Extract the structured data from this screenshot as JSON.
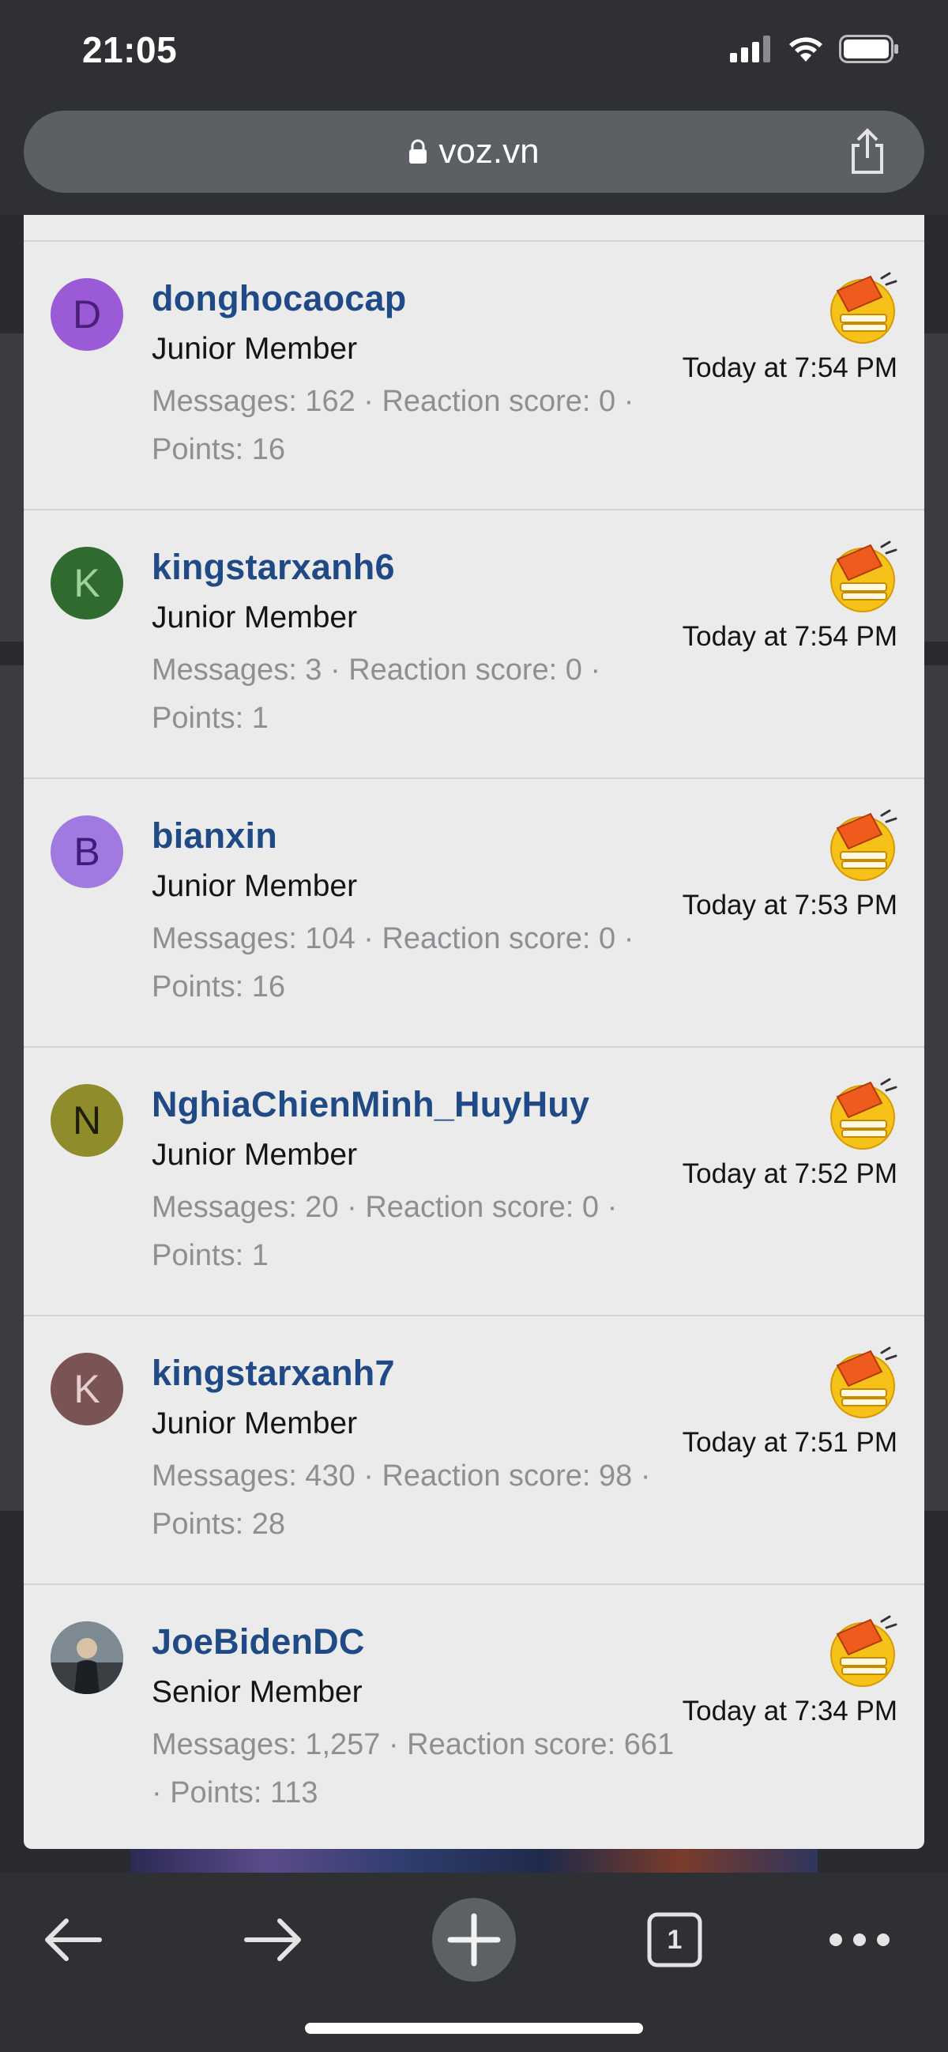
{
  "status_bar": {
    "time": "21:05"
  },
  "address_bar": {
    "domain": "voz.vn"
  },
  "members": [
    {
      "initial": "D",
      "avatar_color": "#9b5bd6",
      "initial_color": "#4a1f7a",
      "username": "donghocaocap",
      "title": "Junior Member",
      "stats": "Messages: 162 · Reaction score: 0 · Points: 16",
      "time": "Today at 7:54 PM"
    },
    {
      "initial": "K",
      "avatar_color": "#2f6b2e",
      "initial_color": "#9ed29a",
      "username": "kingstarxanh6",
      "title": "Junior Member",
      "stats": "Messages: 3 · Reaction score: 0 · Points: 1",
      "time": "Today at 7:54 PM"
    },
    {
      "initial": "B",
      "avatar_color": "#a07ae0",
      "initial_color": "#3d1e78",
      "username": "bianxin",
      "title": "Junior Member",
      "stats": "Messages: 104 · Reaction score: 0 · Points: 16",
      "time": "Today at 7:53 PM"
    },
    {
      "initial": "N",
      "avatar_color": "#8f8c2c",
      "initial_color": "#1e1e08",
      "username": "NghiaChienMinh_HuyHuy",
      "title": "Junior Member",
      "stats": "Messages: 20 · Reaction score: 0 · Points: 1",
      "time": "Today at 7:52 PM"
    },
    {
      "initial": "K",
      "avatar_color": "#7a5454",
      "initial_color": "#e6cfcf",
      "username": "kingstarxanh7",
      "title": "Junior Member",
      "stats": "Messages: 430 · Reaction score: 98 · Points: 28",
      "time": "Today at 7:51 PM"
    },
    {
      "initial": "",
      "avatar_color": "#5a6a74",
      "initial_color": "#ffffff",
      "username": "JoeBidenDC",
      "title": "Senior Member",
      "stats": "Messages: 1,257 · Reaction score: 661 · Points: 113",
      "time": "Today at 7:34 PM"
    }
  ],
  "toolbar": {
    "tab_count": "1"
  },
  "icons": [
    "signal-icon",
    "wifi-icon",
    "battery-icon",
    "lock-icon",
    "share-icon",
    "reaction-emoji-icon",
    "back-arrow-icon",
    "forward-arrow-icon",
    "new-tab-plus-icon",
    "tabs-icon",
    "more-icon"
  ]
}
